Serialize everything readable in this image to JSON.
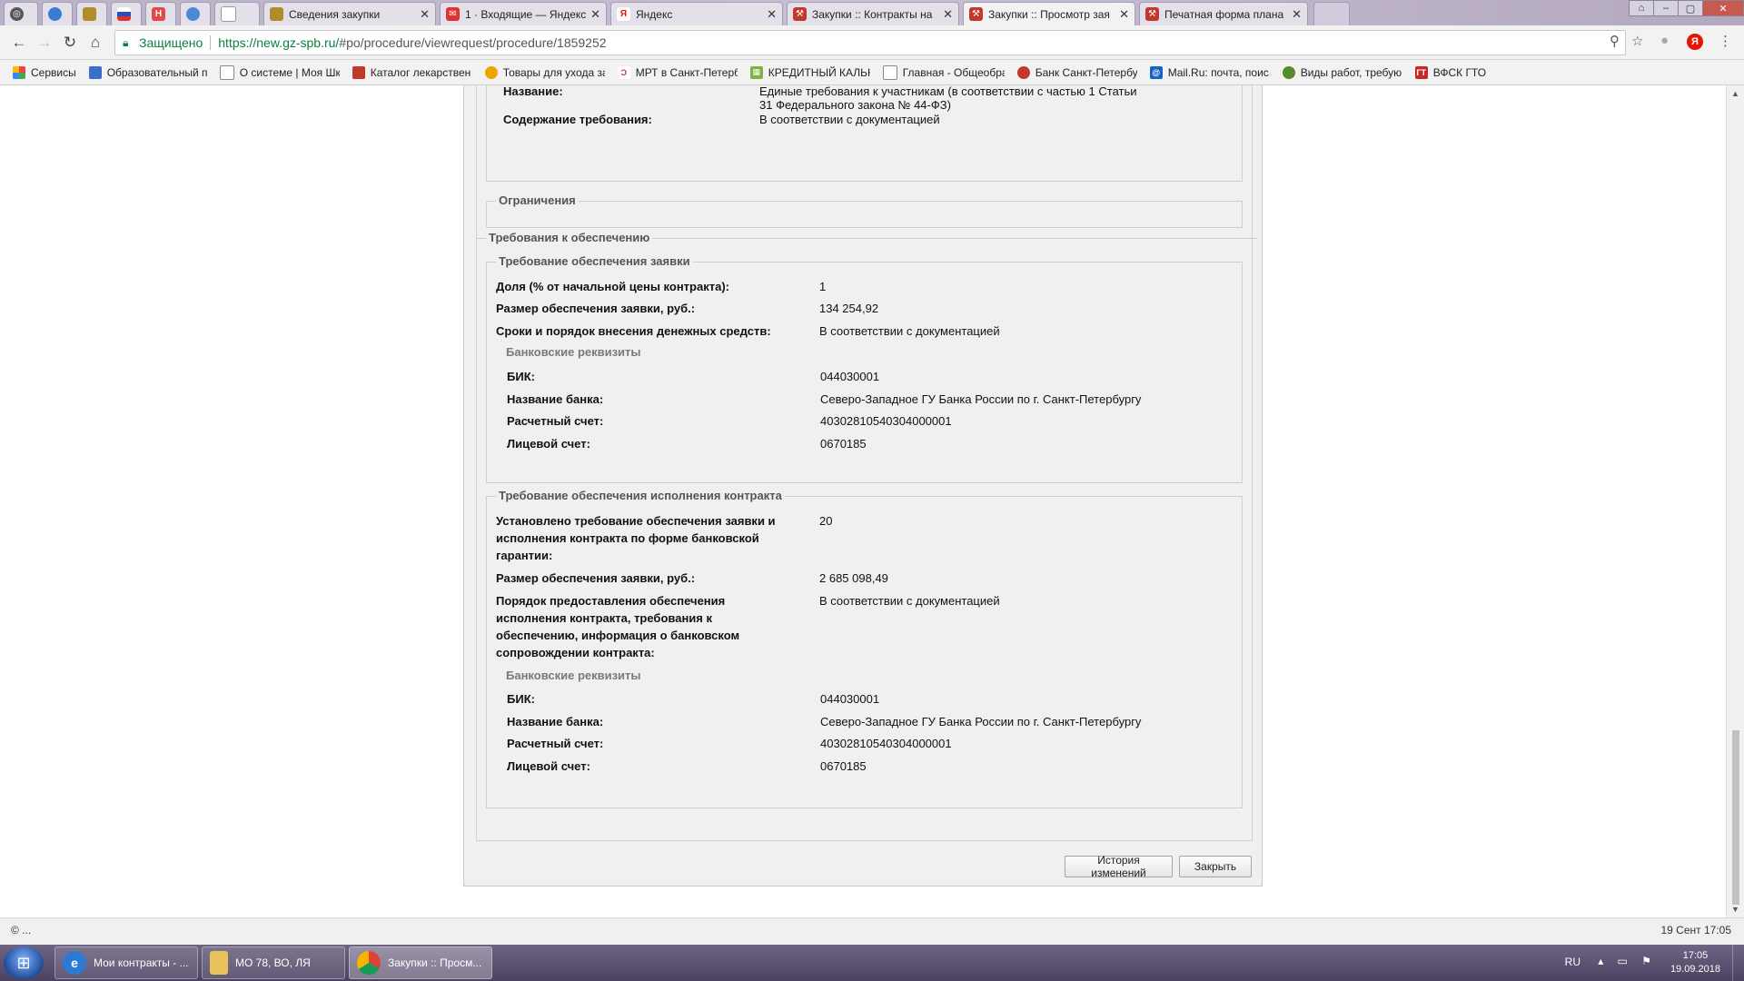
{
  "browser": {
    "tabs": [
      {
        "label": "",
        "color": "#555"
      },
      {
        "label": "",
        "color": "#3a7bd5"
      },
      {
        "label": "",
        "color": "#b08d2a"
      },
      {
        "label": "",
        "color": "#d33"
      },
      {
        "label": "",
        "color": "#e04a4a"
      },
      {
        "label": "",
        "color": "#4a8ad4"
      },
      {
        "label": "",
        "color": "#999"
      },
      {
        "label": "Сведения закупки",
        "color": "#b08d2a"
      },
      {
        "label": "1 · Входящие — Яндекс.",
        "color": "#d33"
      },
      {
        "label": "Яндекс",
        "color": "#e61400"
      },
      {
        "label": "Закупки :: Контракты на",
        "color": "#c0392b"
      },
      {
        "label": "Закупки :: Просмотр зая",
        "color": "#c0392b"
      },
      {
        "label": "Печатная форма плана",
        "color": "#c0392b"
      }
    ],
    "address": {
      "secure_label": "Защищено",
      "url_host": "https://new.gz-spb.ru/",
      "url_path": "#po/procedure/viewrequest/procedure/1859252"
    },
    "bookmarks": [
      {
        "label": "Сервисы",
        "color": "#e44"
      },
      {
        "label": "Образовательный п",
        "color": "#3b6fc9"
      },
      {
        "label": "О системе | Моя Шк",
        "color": "#888"
      },
      {
        "label": "Каталог лекарствен",
        "color": "#c0392b"
      },
      {
        "label": "Товары для ухода за",
        "color": "#f0a400"
      },
      {
        "label": "МРТ в Санкт-Петерб",
        "color": "#c0392b"
      },
      {
        "label": "КРЕДИТНЫЙ КАЛЬК",
        "color": "#7cb342"
      },
      {
        "label": "Главная - Общеобра",
        "color": "#888"
      },
      {
        "label": "Банк Санкт-Петербу",
        "color": "#c0392b"
      },
      {
        "label": "Mail.Ru: почта, поис",
        "color": "#1565c0"
      },
      {
        "label": "Виды работ, требую",
        "color": "#558b2f"
      },
      {
        "label": "ВФСК ГТО",
        "color": "#c62828"
      }
    ]
  },
  "page": {
    "top": {
      "name_label": "Название:",
      "name_value_1": "Единые требования к участникам (в соответствии с частью 1 Статьи",
      "name_value_2": "31 Федерального закона № 44-ФЗ)",
      "content_label": "Содержание требования:",
      "content_value": "В соответствии с документацией",
      "restrictions_legend": "Ограничения"
    },
    "security": {
      "legend": "Требования к обеспечению",
      "bid": {
        "legend": "Требование обеспечения заявки",
        "share_label": "Доля (% от начальной цены контракта):",
        "share_value": "1",
        "amount_label": "Размер обеспечения заявки, руб.:",
        "amount_value": "134 254,92",
        "terms_label": "Сроки и порядок внесения денежных средств:",
        "terms_value": "В соответствии с документацией",
        "bank_legend": "Банковские реквизиты",
        "bik_label": "БИК:",
        "bik_value": "044030001",
        "bank_label": "Название банка:",
        "bank_value": "Северо-Западное ГУ Банка России по г. Санкт-Петербургу",
        "account_label": "Расчетный счет:",
        "account_value": "40302810540304000001",
        "personal_label": "Лицевой счет:",
        "personal_value": "0670185"
      },
      "contract": {
        "legend": "Требование обеспечения исполнения контракта",
        "guarantee_label_1": "Установлено требование обеспечения заявки и",
        "guarantee_label_2": "исполнения контракта по форме банковской",
        "guarantee_label_3": "гарантии:",
        "guarantee_value": "20",
        "amount_label": "Размер обеспечения заявки, руб.:",
        "amount_value": "2 685 098,49",
        "order_label_1": "Порядок предоставления обеспечения",
        "order_label_2": "исполнения контракта, требования к",
        "order_label_3": "обеспечению, информация о банковском",
        "order_label_4": "сопровождении контракта:",
        "order_value": "В соответствии с документацией",
        "bank_legend": "Банковские реквизиты",
        "bik_label": "БИК:",
        "bik_value": "044030001",
        "bank_label": "Название банка:",
        "bank_value": "Северо-Западное ГУ Банка России по г. Санкт-Петербургу",
        "account_label": "Расчетный счет:",
        "account_value": "40302810540304000001",
        "personal_label": "Лицевой счет:",
        "personal_value": "0670185"
      }
    },
    "buttons": {
      "history": "История изменений",
      "close": "Закрыть"
    }
  },
  "statusbar": {
    "left": "© ...",
    "right": "19 Сент 17:05"
  },
  "taskbar": {
    "items": [
      {
        "label": "Мои контракты - ..."
      },
      {
        "label": "МО 78, ВО, ЛЯ"
      },
      {
        "label": "Закупки :: Просм..."
      }
    ],
    "lang": "RU",
    "time": "17:05",
    "date": "19.09.2018"
  }
}
